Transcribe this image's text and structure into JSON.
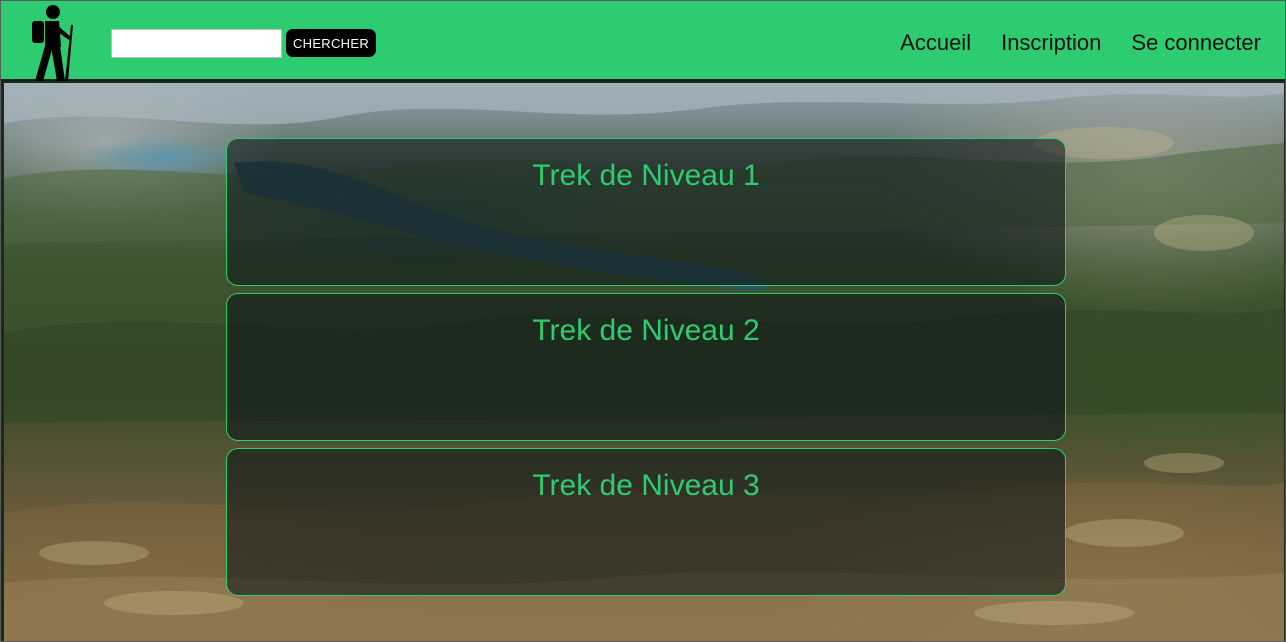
{
  "header": {
    "logo_icon": "hiker-icon",
    "search": {
      "value": "",
      "placeholder": ""
    },
    "search_button_label": "CHERCHER",
    "nav": [
      {
        "label": "Accueil"
      },
      {
        "label": "Inscription"
      },
      {
        "label": "Se connecter"
      }
    ]
  },
  "treks": [
    {
      "title": "Trek de Niveau 1"
    },
    {
      "title": "Trek de Niveau 2"
    },
    {
      "title": "Trek de Niveau 3"
    }
  ],
  "colors": {
    "accent": "#2ecc71",
    "header_bg": "#2ecc71",
    "button_bg": "#000000"
  }
}
